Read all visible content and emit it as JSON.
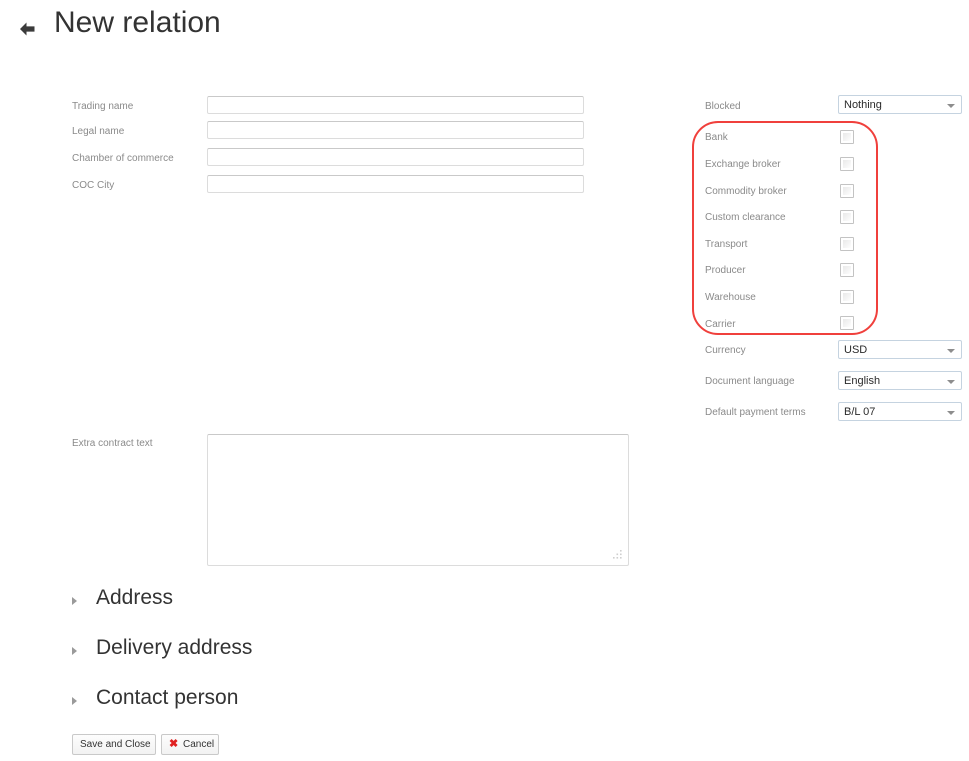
{
  "header": {
    "back_icon": "arrow-left-icon",
    "title": "New relation"
  },
  "left_form": {
    "fields": [
      {
        "label": "Trading name",
        "value": "",
        "placeholder": ""
      },
      {
        "label": "Legal name",
        "value": "",
        "placeholder": ""
      },
      {
        "label": "Chamber of commerce",
        "value": "",
        "placeholder": ""
      },
      {
        "label": "COC City",
        "value": "",
        "placeholder": ""
      }
    ],
    "textarea": {
      "label": "Extra contract text",
      "value": "",
      "placeholder": ""
    }
  },
  "right_form": {
    "blocked": {
      "label": "Blocked",
      "value": "Nothing"
    },
    "checkboxes": [
      {
        "label": "Bank",
        "checked": false
      },
      {
        "label": "Exchange broker",
        "checked": false
      },
      {
        "label": "Commodity broker",
        "checked": false
      },
      {
        "label": "Custom clearance",
        "checked": false
      },
      {
        "label": "Transport",
        "checked": false
      },
      {
        "label": "Producer",
        "checked": false
      },
      {
        "label": "Warehouse",
        "checked": false
      },
      {
        "label": "Carrier",
        "checked": false
      }
    ],
    "selects": [
      {
        "label": "Currency",
        "value": "USD"
      },
      {
        "label": "Document language",
        "value": "English"
      },
      {
        "label": "Default payment terms",
        "value": "B/L 07"
      }
    ]
  },
  "annotation": {
    "color": "#f0403c",
    "shape": "rounded-rectangle"
  },
  "sections": [
    {
      "label": "Address",
      "expanded": false
    },
    {
      "label": "Delivery address",
      "expanded": false
    },
    {
      "label": "Contact person",
      "expanded": false
    }
  ],
  "actions": {
    "save_label": "Save and Close",
    "cancel_label": "Cancel",
    "cancel_icon": "close-x-icon",
    "cancel_icon_glyph": "✖",
    "cancel_icon_color": "#e02020"
  }
}
